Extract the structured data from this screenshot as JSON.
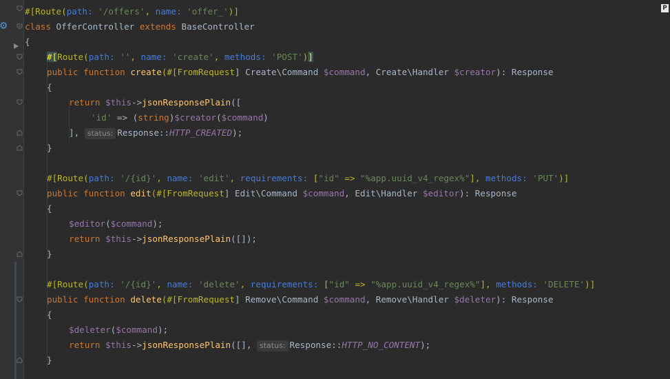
{
  "editor": {
    "corner_badge": "P",
    "hints": {
      "status": "status:"
    },
    "lines": {
      "l1": {
        "a": "#[",
        "b": "Route",
        "c": "(",
        "d": "path: ",
        "e": "'/offers'",
        "f": ", ",
        "g": "name: ",
        "h": "'offer_'",
        "i": ")]"
      },
      "l2": {
        "a": "class ",
        "b": "OfferController ",
        "c": "extends ",
        "d": "BaseController"
      },
      "l3": {
        "a": "{"
      },
      "l4": {
        "a": "#[",
        "b": "Route",
        "c": "(",
        "d": "path: ",
        "e": "''",
        "f": ", ",
        "g": "name: ",
        "h": "'create'",
        "i": ", ",
        "j": "methods: ",
        "k": "'POST'",
        "l": ")",
        "m": "]"
      },
      "l5": {
        "a": "public function ",
        "b": "create",
        "c": "(#[",
        "d": "FromRequest",
        "e": "] Create\\Command ",
        "f": "$command",
        "g": ", Create\\Handler ",
        "h": "$creator",
        "i": "): Response"
      },
      "l6": {
        "a": "{"
      },
      "l7": {
        "a": "return ",
        "b": "$this",
        "c": "->",
        "d": "jsonResponsePlain",
        "e": "(["
      },
      "l8": {
        "a": "'id'",
        "b": " => (",
        "c": "string",
        "d": ")",
        "e": "$creator",
        "f": "(",
        "g": "$command",
        "h": ")"
      },
      "l9": {
        "a": "], ",
        "b": "Response::",
        "c": "HTTP_CREATED",
        "d": ");"
      },
      "l10": {
        "a": "}"
      },
      "l12": {
        "a": "#[",
        "b": "Route",
        "c": "(",
        "d": "path: ",
        "e": "'/{id}'",
        "f": ", ",
        "g": "name: ",
        "h": "'edit'",
        "i": ", ",
        "j": "requirements: ",
        "k": "[",
        "l": "\"id\"",
        "m": " => ",
        "n": "\"%app.uuid_v4_regex%\"",
        "o": "], ",
        "p": "methods: ",
        "q": "'PUT'",
        "r": ")]"
      },
      "l13": {
        "a": "public function ",
        "b": "edit",
        "c": "(#[",
        "d": "FromRequest",
        "e": "] Edit\\Command ",
        "f": "$command",
        "g": ", Edit\\Handler ",
        "h": "$editor",
        "i": "): Response"
      },
      "l14": {
        "a": "{"
      },
      "l15": {
        "a": "$editor",
        "b": "(",
        "c": "$command",
        "d": ");"
      },
      "l16": {
        "a": "return ",
        "b": "$this",
        "c": "->",
        "d": "jsonResponsePlain",
        "e": "([]);"
      },
      "l17": {
        "a": "}"
      },
      "l19": {
        "a": "#[",
        "b": "Route",
        "c": "(",
        "d": "path: ",
        "e": "'/{id}'",
        "f": ", ",
        "g": "name: ",
        "h": "'delete'",
        "i": ", ",
        "j": "requirements: ",
        "k": "[",
        "l": "\"id\"",
        "m": " => ",
        "n": "\"%app.uuid_v4_regex%\"",
        "o": "], ",
        "p": "methods: ",
        "q": "'DELETE'",
        "r": ")]"
      },
      "l20": {
        "a": "public function ",
        "b": "delete",
        "c": "(#[",
        "d": "FromRequest",
        "e": "] Remove\\Command ",
        "f": "$command",
        "g": ", Remove\\Handler ",
        "h": "$deleter",
        "i": "): Response"
      },
      "l21": {
        "a": "{"
      },
      "l22": {
        "a": "$deleter",
        "b": "(",
        "c": "$command",
        "d": ");"
      },
      "l23": {
        "a": "return ",
        "b": "$this",
        "c": "->",
        "d": "jsonResponsePlain",
        "e": "([], ",
        "f": "Response::",
        "g": "HTTP_NO_CONTENT",
        "h": ");"
      },
      "l24": {
        "a": "}"
      }
    }
  },
  "colors": {
    "background": "#2b2b2b",
    "keyword": "#cc7832",
    "attribute": "#bbb529",
    "string": "#6a8759",
    "function": "#ffc66d",
    "variable": "#9876aa",
    "param_name": "#467cda"
  },
  "icons": {
    "gutter_gear": "gear-icon",
    "run_marker": "run-arrow-icon",
    "fold": "fold-icon"
  }
}
